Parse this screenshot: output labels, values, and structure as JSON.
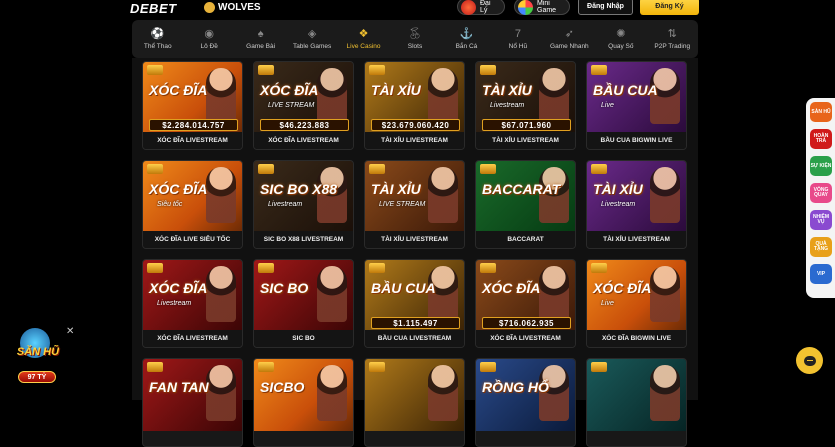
{
  "header": {
    "logo": "DEBET",
    "partner_logo": "WOLVES",
    "daily_label": "Đại Lý",
    "mini_game_label": "Mini Game",
    "login_label": "Đăng Nhập",
    "register_label": "Đăng Ký"
  },
  "nav": {
    "items": [
      {
        "label": "Thể Thao",
        "icon": "soccer-ball-icon"
      },
      {
        "label": "Lô Đề",
        "icon": "lottery-ball-icon"
      },
      {
        "label": "Game Bài",
        "icon": "cards-icon"
      },
      {
        "label": "Table Games",
        "icon": "poker-chip-icon"
      },
      {
        "label": "Live Casino",
        "icon": "live-casino-icon",
        "active": true
      },
      {
        "label": "Slots",
        "icon": "cherry-icon"
      },
      {
        "label": "Bắn Cá",
        "icon": "fish-icon"
      },
      {
        "label": "Nổ Hũ",
        "icon": "seven-icon"
      },
      {
        "label": "Game Nhanh",
        "icon": "rocket-icon"
      },
      {
        "label": "Quay Số",
        "icon": "wheel-icon"
      },
      {
        "label": "P2P Trading",
        "icon": "trading-icon"
      }
    ]
  },
  "games": [
    {
      "name": "XÓC ĐĨA LIVESTREAM",
      "title": "XÓC ĐĨA",
      "sub": "",
      "jackpot": "$2.284.014.757",
      "theme": "t-orange"
    },
    {
      "name": "XÓC ĐĨA LIVESTREAM",
      "title": "XÓC ĐĨA",
      "sub": "LIVE STREAM",
      "jackpot": "$46.223.883",
      "theme": "t-dark"
    },
    {
      "name": "TÀI XỈU LIVESTREAM",
      "title": "TÀI XỈU",
      "sub": "",
      "jackpot": "$23.679.060.420",
      "theme": "t-gold"
    },
    {
      "name": "TÀI XỈU LIVESTREAM",
      "title": "TÀI XỈU",
      "sub": "Livestream",
      "jackpot": "$67.071.960",
      "theme": "t-dark"
    },
    {
      "name": "BẦU CUA BIGWIN LIVE",
      "title": "BẦU CUA",
      "sub": "Live",
      "jackpot": "",
      "theme": "t-purple"
    },
    {
      "name": "XÓC ĐĨA LIVE SIÊU TỐC",
      "title": "XÓC ĐĨA",
      "sub": "Siêu tốc",
      "jackpot": "",
      "theme": "t-orange"
    },
    {
      "name": "SIC BO X88 LIVESTREAM",
      "title": "SIC BO X88",
      "sub": "Livestream",
      "jackpot": "",
      "theme": "t-dark"
    },
    {
      "name": "TÀI XỈU LIVESTREAM",
      "title": "TÀI XỈU",
      "sub": "LIVE STREAM",
      "jackpot": "",
      "theme": "t-brown"
    },
    {
      "name": "BACCARAT",
      "title": "BACCARAT",
      "sub": "",
      "jackpot": "",
      "theme": "t-green"
    },
    {
      "name": "TÀI XỈU LIVESTREAM",
      "title": "TÀI XỈU",
      "sub": "Livestream",
      "jackpot": "",
      "theme": "t-purple"
    },
    {
      "name": "XÓC ĐĨA LIVESTREAM",
      "title": "XÓC ĐĨA",
      "sub": "Livestream",
      "jackpot": "",
      "theme": "t-red"
    },
    {
      "name": "SIC BO",
      "title": "SIC BO",
      "sub": "",
      "jackpot": "",
      "theme": "t-red"
    },
    {
      "name": "BẦU CUA LIVESTREAM",
      "title": "BẦU CUA",
      "sub": "",
      "jackpot": "$1.115.497",
      "theme": "t-gold"
    },
    {
      "name": "XÓC ĐĨA LIVESTREAM",
      "title": "XÓC ĐĨA",
      "sub": "",
      "jackpot": "$716.062.935",
      "theme": "t-brown"
    },
    {
      "name": "XÓC ĐĨA BIGWIN LIVE",
      "title": "XÓC ĐĨA",
      "sub": "Live",
      "jackpot": "",
      "theme": "t-orange"
    },
    {
      "name": "",
      "title": "FAN TAN",
      "sub": "",
      "jackpot": "",
      "theme": "t-red"
    },
    {
      "name": "",
      "title": "SICBO",
      "sub": "",
      "jackpot": "",
      "theme": "t-orange"
    },
    {
      "name": "",
      "title": "",
      "sub": "",
      "jackpot": "",
      "theme": "t-gold"
    },
    {
      "name": "",
      "title": "RỒNG HỔ",
      "sub": "",
      "jackpot": "",
      "theme": "t-blue"
    },
    {
      "name": "",
      "title": "",
      "sub": "",
      "jackpot": "",
      "theme": "t-teal"
    }
  ],
  "side_bar": {
    "items": [
      {
        "label": "SÀN HŨ",
        "color": "#e8641a"
      },
      {
        "label": "HOÀN TRẢ",
        "color": "#d01a1a"
      },
      {
        "label": "SỰ KIỆN",
        "color": "#2aa04a"
      },
      {
        "label": "VÒNG QUAY",
        "color": "#e84a8a"
      },
      {
        "label": "NHIỆM VỤ",
        "color": "#8a4ad0"
      },
      {
        "label": "QUÀ TẶNG",
        "color": "#e8a01a"
      },
      {
        "label": "VIP",
        "color": "#2a6ad0"
      }
    ]
  },
  "promo": {
    "label": "SĂN HŨ",
    "amount": "97 TỶ"
  }
}
